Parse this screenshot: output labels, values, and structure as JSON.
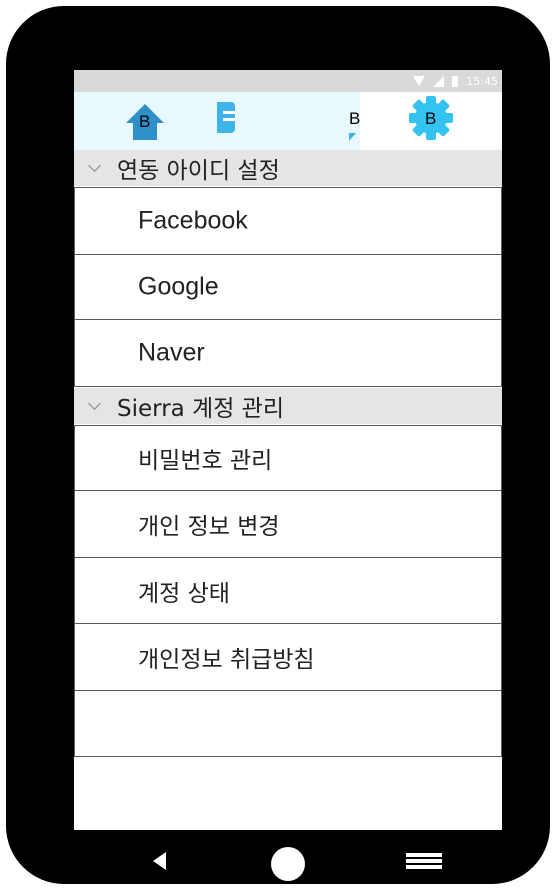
{
  "status_bar": {
    "time": "15:45",
    "icons": [
      "wifi-icon",
      "signal-icon",
      "battery-icon"
    ]
  },
  "tabs": [
    {
      "name": "home",
      "icon": "home-icon",
      "letter": "B",
      "color": "#2f8fc8"
    },
    {
      "name": "chat",
      "icon": "chat-icon",
      "letter": "B",
      "color": "#3fb4e6"
    },
    {
      "name": "settings",
      "icon": "gear-icon",
      "letter": "B",
      "color": "#33c3f0",
      "selected": true
    }
  ],
  "sections": [
    {
      "title": "연동 아이디 설정",
      "items": [
        "Facebook",
        "Google",
        "Naver"
      ]
    },
    {
      "title": "Sierra 계정 관리",
      "items": [
        "비밀번호 관리",
        "개인 정보 변경",
        "계정 상태",
        "개인정보 취급방침"
      ]
    }
  ],
  "nav_bar": {
    "icons": [
      "back-icon",
      "home-circle-icon",
      "menu-icon"
    ]
  },
  "colors": {
    "frame": "#000000",
    "tab_bar_bg": "#e9f8fd",
    "section_header_bg": "#e5e5e5",
    "status_bar_bg": "#d9d9d9"
  }
}
